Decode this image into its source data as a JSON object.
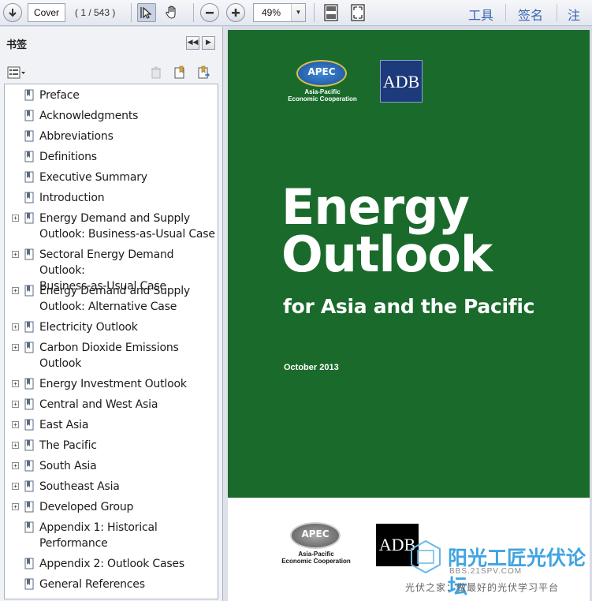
{
  "toolbar": {
    "page_field_value": "Cover",
    "page_count": "( 1 / 543 )",
    "zoom_value": "49%",
    "menu": [
      "工具",
      "签名",
      "注释"
    ]
  },
  "panel": {
    "title": "书签"
  },
  "bookmarks": [
    {
      "label": "Preface",
      "expandable": false
    },
    {
      "label": "Acknowledgments",
      "expandable": false
    },
    {
      "label": "Abbreviations",
      "expandable": false
    },
    {
      "label": "Definitions",
      "expandable": false
    },
    {
      "label": "Executive Summary",
      "expandable": false
    },
    {
      "label": "Introduction",
      "expandable": false
    },
    {
      "label": "Energy Demand and Supply\nOutlook: Business-as-Usual Case",
      "expandable": true
    },
    {
      "label": "Sectoral Energy Demand Outlook:\nBusiness-as-Usual Case",
      "expandable": true
    },
    {
      "label": "Energy Demand and Supply\nOutlook: Alternative Case",
      "expandable": true
    },
    {
      "label": "Electricity Outlook",
      "expandable": true
    },
    {
      "label": "Carbon Dioxide Emissions\nOutlook",
      "expandable": true
    },
    {
      "label": "Energy Investment Outlook",
      "expandable": true
    },
    {
      "label": "Central and West Asia",
      "expandable": true
    },
    {
      "label": "East Asia",
      "expandable": true
    },
    {
      "label": "The Pacific",
      "expandable": true
    },
    {
      "label": "South Asia",
      "expandable": true
    },
    {
      "label": "Southeast Asia",
      "expandable": true
    },
    {
      "label": "Developed Group",
      "expandable": true
    },
    {
      "label": "Appendix 1: Historical\nPerformance",
      "expandable": false
    },
    {
      "label": "Appendix 2: Outlook Cases",
      "expandable": false
    },
    {
      "label": "General References",
      "expandable": false
    }
  ],
  "cover": {
    "apec_logo_text": "APEC",
    "apec_sub_line1": "Asia-Pacific",
    "apec_sub_line2": "Economic Cooperation",
    "adb_logo_text": "ADB",
    "title_line1": "Energy",
    "title_line2": "Outlook",
    "subtitle": "for Asia and the Pacific",
    "date": "October 2013",
    "background_color": "#1a6b2b"
  },
  "watermark": {
    "title": "阳光工匠光伏论坛",
    "url": "BBS.21SPV.COM",
    "slogan": "光伏之家：做最好的光伏学习平台"
  }
}
